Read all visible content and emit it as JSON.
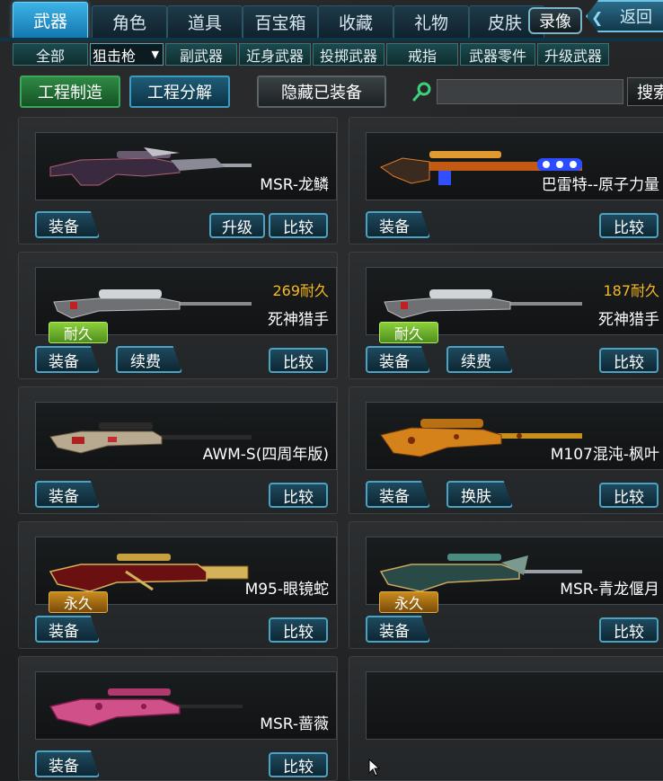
{
  "top_tabs": [
    "武器",
    "角色",
    "道具",
    "百宝箱",
    "收藏",
    "礼物",
    "皮肤"
  ],
  "record_label": "录像",
  "back_label": "返回",
  "sub_tabs": [
    "全部",
    "副武器",
    "近身武器",
    "投掷武器",
    "戒指",
    "武器零件",
    "升级武器"
  ],
  "sub_select_value": "狙击枪",
  "actions": {
    "craft": "工程制造",
    "decompose": "工程分解",
    "hide_equipped": "隐藏已装备"
  },
  "search": {
    "button": "搜索",
    "value": ""
  },
  "items": [
    {
      "name": "MSR-龙鳞",
      "durability": "",
      "badge": "",
      "buttons": [
        "装备",
        "升级",
        "比较"
      ]
    },
    {
      "name": "巴雷特--原子力量",
      "durability": "",
      "badge": "",
      "buttons": [
        "装备",
        "比较"
      ]
    },
    {
      "name": "死神猎手",
      "durability": "269耐久",
      "badge": "耐久",
      "buttons": [
        "装备",
        "续费",
        "比较"
      ]
    },
    {
      "name": "死神猎手",
      "durability": "187耐久",
      "badge": "耐久",
      "buttons": [
        "装备",
        "续费",
        "比较"
      ]
    },
    {
      "name": "AWM-S(四周年版)",
      "durability": "",
      "badge": "",
      "buttons": [
        "装备",
        "比较"
      ]
    },
    {
      "name": "M107混沌-枫叶",
      "durability": "",
      "badge": "",
      "buttons": [
        "装备",
        "换肤",
        "比较"
      ]
    },
    {
      "name": "M95-眼镜蛇",
      "durability": "",
      "badge": "永久",
      "buttons": [
        "装备",
        "比较"
      ]
    },
    {
      "name": "MSR-青龙偃月",
      "durability": "",
      "badge": "永久",
      "buttons": [
        "装备",
        "比较"
      ]
    },
    {
      "name": "MSR-蔷薇",
      "durability": "",
      "badge": "",
      "buttons": [
        "装备",
        "比较"
      ]
    }
  ]
}
